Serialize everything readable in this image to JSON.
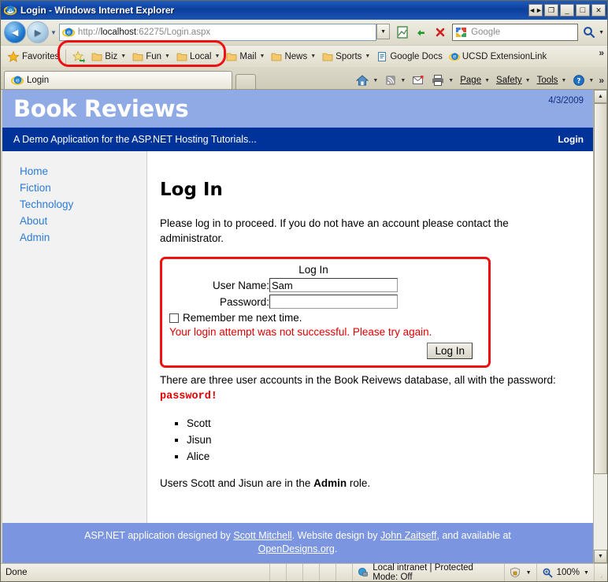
{
  "window": {
    "title": "Login - Windows Internet Explorer",
    "icon": "ie-logo-icon",
    "buttons": {
      "restore_small": "◄►",
      "restore_down": "❐",
      "minimize": "_",
      "maximize": "□",
      "close": "✕"
    }
  },
  "navigation": {
    "back_glyph": "◄",
    "forward_glyph": "►",
    "history_caret": "▼",
    "address": {
      "scheme": "http://",
      "host": "localhost",
      "rest": ":62275/Login.aspx",
      "full": "http://localhost:62275/Login.aspx",
      "dropdown_caret": "▼"
    },
    "buttons": [
      "compatibility-view-icon",
      "refresh-icon",
      "stop-icon"
    ],
    "search": {
      "provider": "Google",
      "placeholder": "Google",
      "go_caret": "▼"
    }
  },
  "favorites_bar": {
    "favorites_label": "Favorites",
    "items": [
      {
        "label": "",
        "icon": "add-favorite-icon",
        "caret": ""
      },
      {
        "label": "Biz",
        "icon": "folder-icon",
        "caret": "▼"
      },
      {
        "label": "Fun",
        "icon": "folder-icon",
        "caret": "▼"
      },
      {
        "label": "Local",
        "icon": "folder-icon",
        "caret": "▼"
      },
      {
        "label": "Mail",
        "icon": "folder-icon",
        "caret": "▼"
      },
      {
        "label": "News",
        "icon": "folder-icon",
        "caret": "▼"
      },
      {
        "label": "Sports",
        "icon": "folder-icon",
        "caret": "▼"
      },
      {
        "label": "Google Docs",
        "icon": "document-icon",
        "caret": ""
      },
      {
        "label": "UCSD ExtensionLink",
        "icon": "ie-logo-icon",
        "caret": ""
      }
    ],
    "overflow": "»"
  },
  "tabs": {
    "active": {
      "label": "Login",
      "icon": "ie-logo-icon"
    },
    "new_tab_label": ""
  },
  "command_bar": {
    "items": [
      {
        "label": "",
        "icon": "home-icon",
        "caret": "▼"
      },
      {
        "label": "",
        "icon": "feeds-icon",
        "caret": "▼"
      },
      {
        "label": "",
        "icon": "mail-icon",
        "caret": ""
      },
      {
        "label": "",
        "icon": "print-icon",
        "caret": "▼"
      },
      {
        "label": "Page",
        "icon": "",
        "caret": "▼",
        "accel": "P"
      },
      {
        "label": "Safety",
        "icon": "",
        "caret": "▼",
        "accel": "S"
      },
      {
        "label": "Tools",
        "icon": "",
        "caret": "▼",
        "accel": "o"
      },
      {
        "label": "",
        "icon": "help-icon",
        "caret": "▼"
      }
    ],
    "overflow": "»"
  },
  "page": {
    "header": {
      "site_title": "Book Reviews",
      "date": "4/3/2009",
      "tagline": "A Demo Application for the ASP.NET Hosting Tutorials...",
      "login_link": "Login"
    },
    "sidebar": {
      "items": [
        {
          "label": "Home"
        },
        {
          "label": "Fiction"
        },
        {
          "label": "Technology"
        },
        {
          "label": "About"
        },
        {
          "label": "Admin"
        }
      ]
    },
    "main": {
      "heading": "Log In",
      "intro": "Please log in to proceed. If you do not have an account please contact the administrator.",
      "login_form": {
        "title": "Log In",
        "username_label": "User Name:",
        "username_value": "Sam",
        "password_label": "Password:",
        "password_value": "",
        "remember_label": "Remember me next time.",
        "remember_checked": false,
        "error": "Your login attempt was not successful. Please try again.",
        "submit_label": "Log In"
      },
      "accounts_intro_prefix": "There are three user accounts in the Book Reivews database, all with the password: ",
      "accounts_password": "password!",
      "accounts": [
        "Scott",
        "Jisun",
        "Alice"
      ],
      "roles_note_prefix": "Users Scott and Jisun are in the ",
      "roles_note_bold": "Admin",
      "roles_note_suffix": " role."
    },
    "footer": {
      "text_1": "ASP.NET application designed by ",
      "link_1": "Scott Mitchell",
      "text_2": ". Website design by ",
      "link_2": "John Zaitseff",
      "text_3": ", and available at ",
      "link_3": "OpenDesigns.org",
      "text_4": "."
    }
  },
  "status_bar": {
    "status": "Done",
    "zone": "Local intranet | Protected Mode: Off",
    "security_icon": "privacy-lock-icon",
    "zoom": "100%",
    "zoom_icon": "zoom-icon",
    "caret": "▼"
  },
  "scrollbar": {
    "up_arrow": "▲",
    "down_arrow": "▼"
  },
  "colors": {
    "title_bar": "#0d3f9c",
    "site_header": "#8faae4",
    "site_subheader": "#003399",
    "site_footer": "#7b95e0",
    "link_blue": "#2b7bd6",
    "error_red": "#e00000",
    "annotation_red": "#ee1111"
  }
}
